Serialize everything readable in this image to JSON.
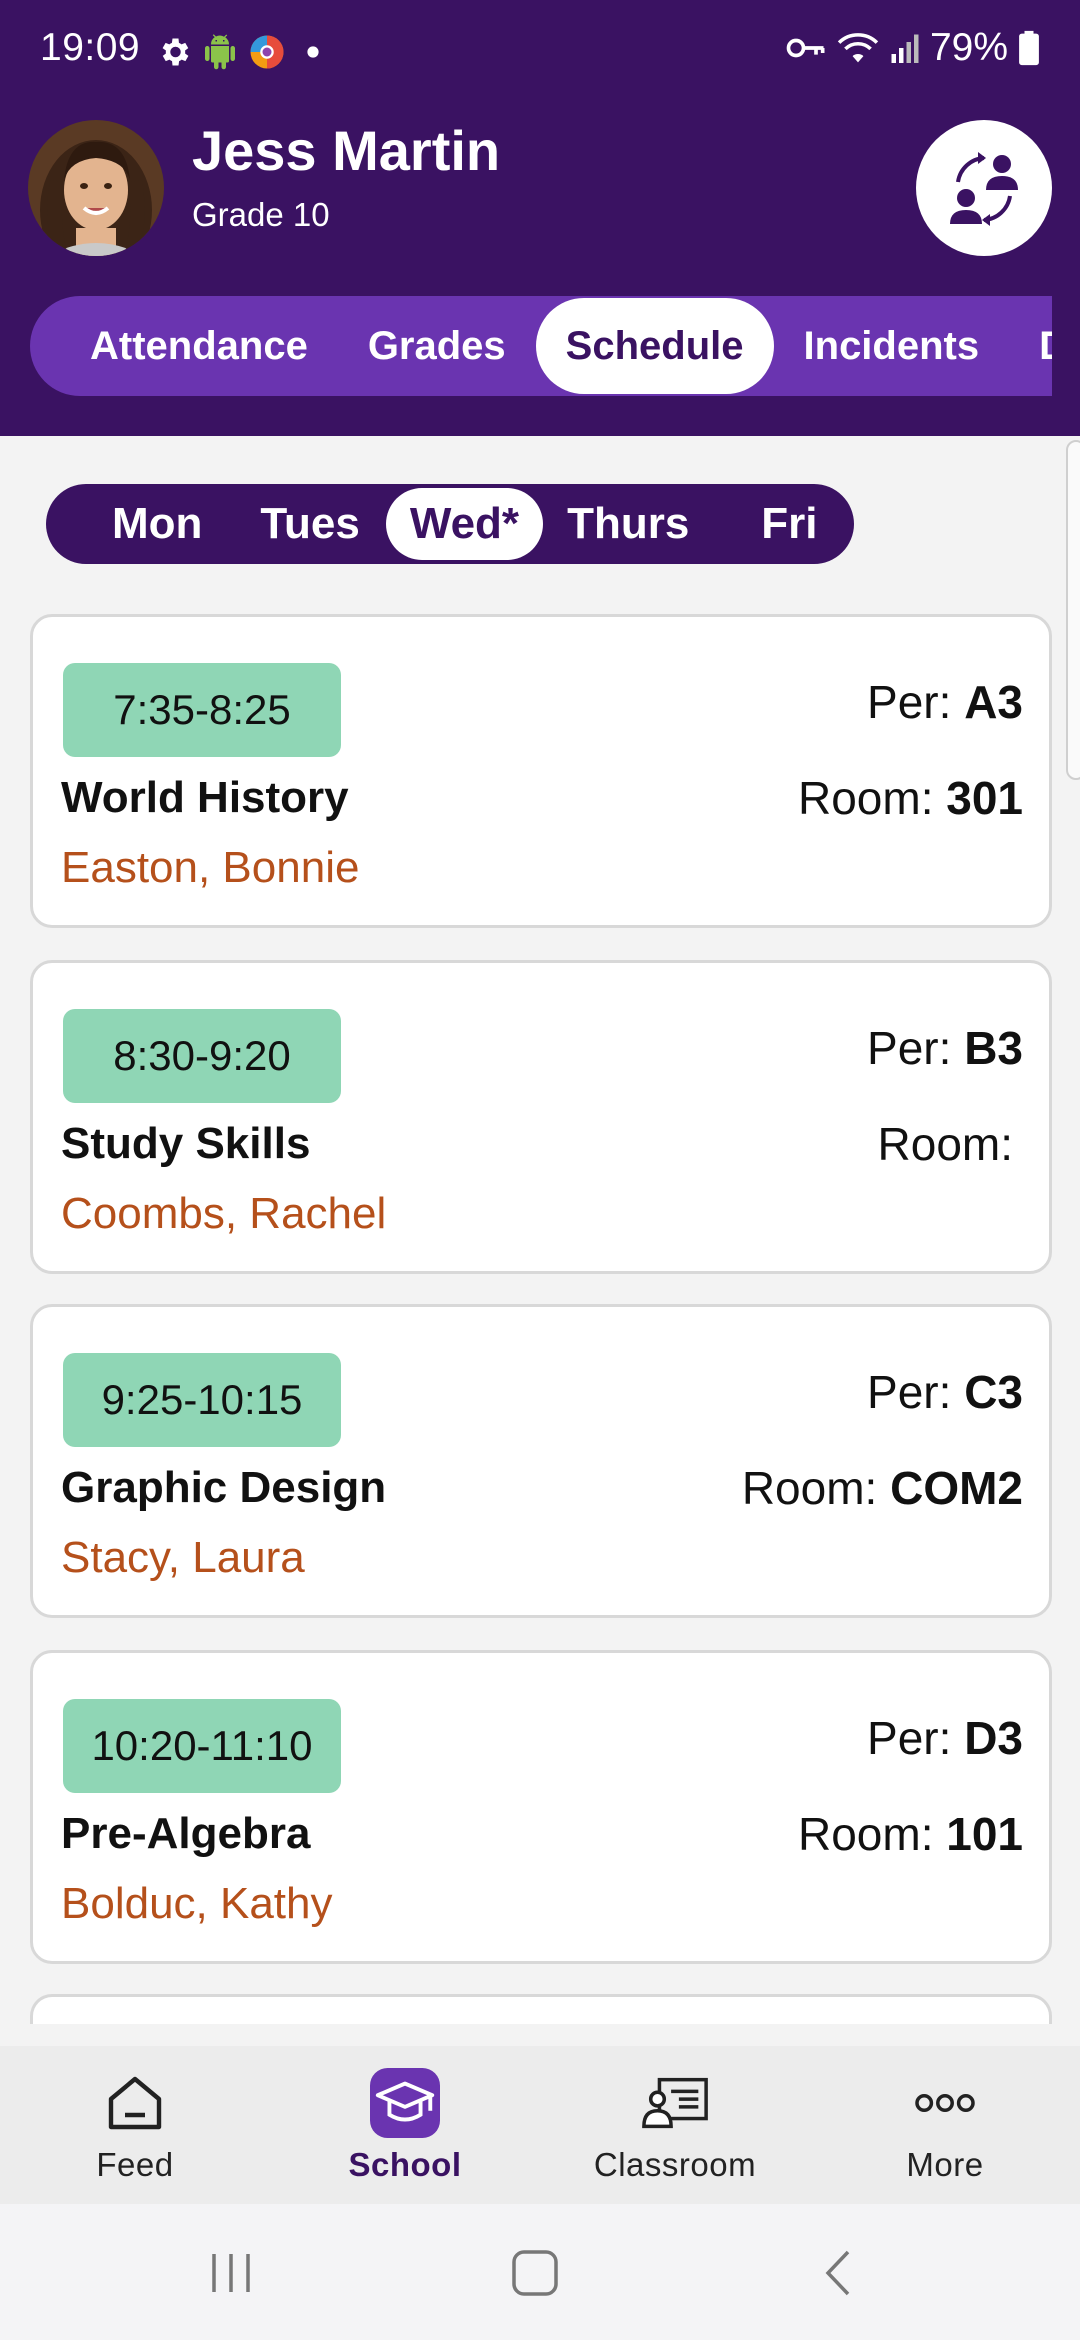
{
  "status": {
    "time": "19:09",
    "battery": "79%"
  },
  "student": {
    "name": "Jess Martin",
    "grade": "Grade 10"
  },
  "main_tabs": [
    {
      "label": "Attendance"
    },
    {
      "label": "Grades"
    },
    {
      "label": "Schedule"
    },
    {
      "label": "Incidents"
    },
    {
      "label": "De"
    }
  ],
  "days": [
    {
      "label": "Mon"
    },
    {
      "label": "Tues"
    },
    {
      "label": "Wed*"
    },
    {
      "label": "Thurs"
    },
    {
      "label": "Fri"
    }
  ],
  "labels": {
    "per": "Per:",
    "room": "Room:"
  },
  "classes": [
    {
      "time": "7:35-8:25",
      "course": "World History",
      "teacher": "Easton, Bonnie",
      "period": "A3",
      "room": "301"
    },
    {
      "time": "8:30-9:20",
      "course": "Study Skills",
      "teacher": "Coombs, Rachel",
      "period": "B3",
      "room": ""
    },
    {
      "time": "9:25-10:15",
      "course": "Graphic Design",
      "teacher": "Stacy, Laura",
      "period": "C3",
      "room": "COM2"
    },
    {
      "time": "10:20-11:10",
      "course": "Pre-Algebra",
      "teacher": "Bolduc, Kathy",
      "period": "D3",
      "room": "101"
    }
  ],
  "bottom_nav": [
    {
      "label": "Feed",
      "icon": "home-icon"
    },
    {
      "label": "School",
      "icon": "school-icon"
    },
    {
      "label": "Classroom",
      "icon": "classroom-icon"
    },
    {
      "label": "More",
      "icon": "more-icon"
    }
  ],
  "colors": {
    "header": "#3a1262",
    "tab_bar": "#6a34b0",
    "time_badge": "#8fd6b5",
    "teacher_text": "#b5501b"
  }
}
